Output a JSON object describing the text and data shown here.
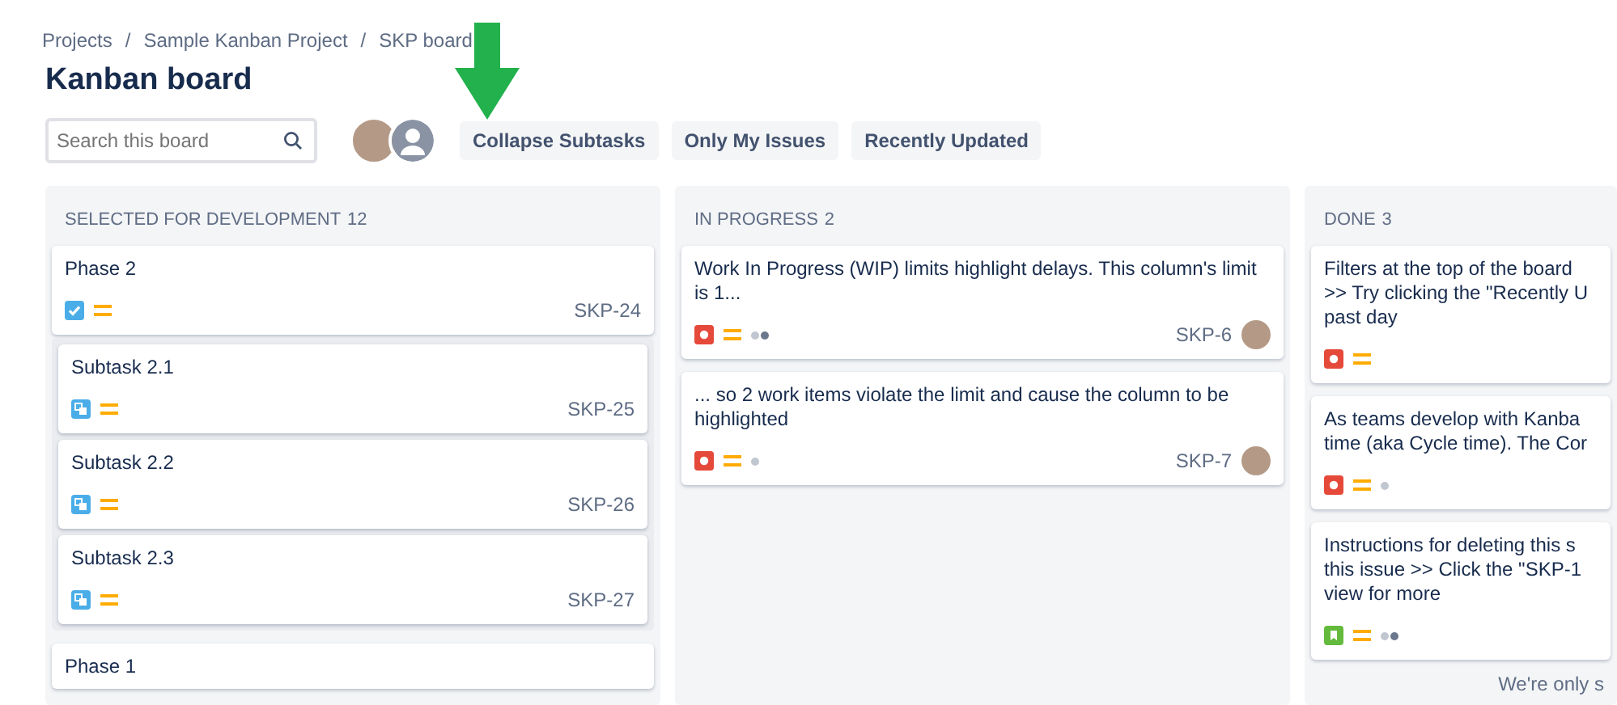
{
  "breadcrumbs": [
    "Projects",
    "Sample Kanban Project",
    "SKP board"
  ],
  "breadcrumb_separator": "/",
  "title": "Kanban board",
  "search": {
    "placeholder": "Search this board"
  },
  "avatars": [
    {
      "kind": "photo"
    },
    {
      "kind": "generic"
    }
  ],
  "filters": [
    {
      "label": "Collapse Subtasks"
    },
    {
      "label": "Only My Issues"
    },
    {
      "label": "Recently Updated"
    }
  ],
  "columns": [
    {
      "name": "SELECTED FOR DEVELOPMENT",
      "count": "12",
      "cards": [
        {
          "lines": [
            "Phase 2"
          ],
          "icons": [
            {
              "kind": "task"
            },
            {
              "kind": "priority"
            }
          ],
          "key": "SKP-24",
          "assigned": false,
          "subtasks": [
            {
              "lines": [
                "Subtask 2.1"
              ],
              "icons": [
                {
                  "kind": "subtask"
                },
                {
                  "kind": "priority"
                }
              ],
              "key": "SKP-25",
              "assigned": false
            },
            {
              "lines": [
                "Subtask 2.2"
              ],
              "icons": [
                {
                  "kind": "subtask"
                },
                {
                  "kind": "priority"
                }
              ],
              "key": "SKP-26",
              "assigned": false
            },
            {
              "lines": [
                "Subtask 2.3"
              ],
              "icons": [
                {
                  "kind": "subtask"
                },
                {
                  "kind": "priority"
                }
              ],
              "key": "SKP-27",
              "assigned": false
            }
          ]
        },
        {
          "lines": [
            "Phase 1"
          ]
        }
      ]
    },
    {
      "name": "IN PROGRESS",
      "count": "2",
      "cards": [
        {
          "lines": [
            "Work In Progress (WIP) limits highlight delays. This column's limit is 1..."
          ],
          "icons": [
            {
              "kind": "bug"
            },
            {
              "kind": "priority"
            },
            {
              "kind": "two-dots"
            }
          ],
          "key": "SKP-6",
          "assigned": true
        },
        {
          "lines": [
            "... so 2 work items violate the limit and cause the column to be highlighted"
          ],
          "icons": [
            {
              "kind": "bug"
            },
            {
              "kind": "priority"
            },
            {
              "kind": "one-dot"
            }
          ],
          "key": "SKP-7",
          "assigned": true
        }
      ]
    },
    {
      "name": "DONE",
      "count": "3",
      "note": "We're only s",
      "cards": [
        {
          "lines": [
            "Filters at the top of the board",
            ">> Try clicking the \"Recently U",
            "past day"
          ],
          "icons": [
            {
              "kind": "bug"
            },
            {
              "kind": "priority"
            }
          ]
        },
        {
          "lines": [
            "As teams develop with Kanba",
            "time (aka Cycle time). The Cor"
          ],
          "icons": [
            {
              "kind": "bug"
            },
            {
              "kind": "priority"
            },
            {
              "kind": "one-dot"
            }
          ]
        },
        {
          "lines": [
            "Instructions for deleting this s",
            "this issue >> Click the \"SKP-1",
            "view for more"
          ],
          "icons": [
            {
              "kind": "story"
            },
            {
              "kind": "priority"
            },
            {
              "kind": "two-dots"
            }
          ]
        }
      ]
    }
  ]
}
